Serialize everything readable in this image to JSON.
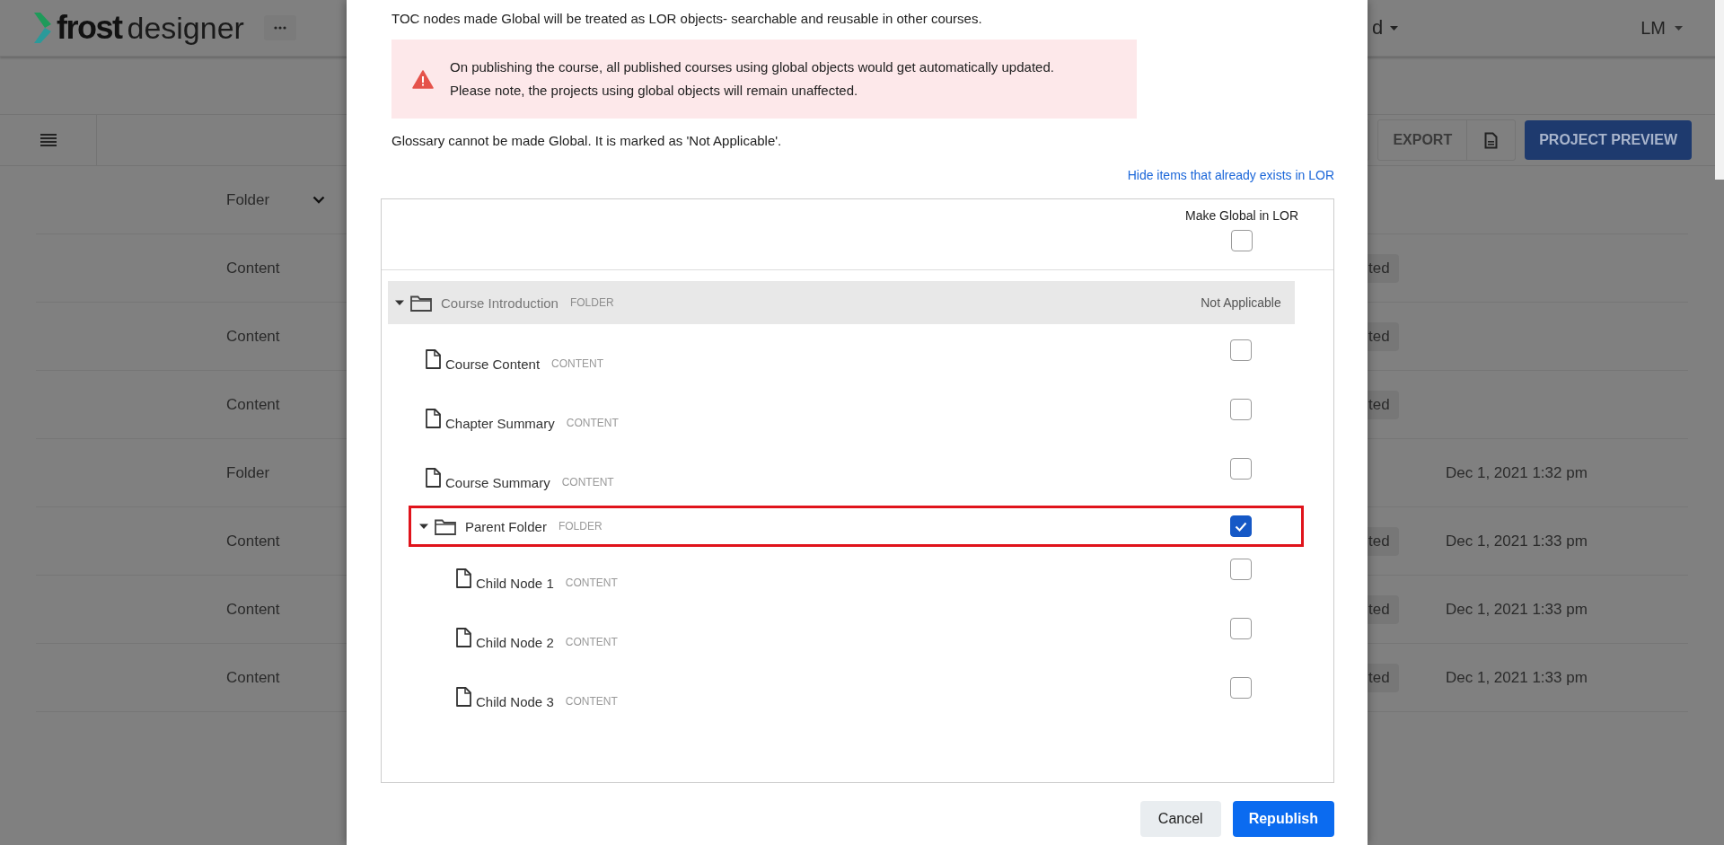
{
  "header": {
    "logo_bold": "frost",
    "logo_light": "designer",
    "menu_partial": "d",
    "user": "LM"
  },
  "toolbar": {
    "export_button": "EXPORT",
    "preview_button": "PROJECT PREVIEW"
  },
  "table": {
    "filter": "Folder",
    "rows": [
      {
        "type": "Content",
        "status": "ted"
      },
      {
        "type": "Content",
        "status": "ted"
      },
      {
        "type": "Content",
        "status": "ted"
      },
      {
        "type": "Folder",
        "date": "Dec 1, 2021 1:32 pm"
      },
      {
        "type": "Content",
        "status": "ted",
        "date": "Dec 1, 2021 1:33 pm"
      },
      {
        "type": "Content",
        "status": "ted",
        "date": "Dec 1, 2021 1:33 pm"
      },
      {
        "type": "Content",
        "status": "ted",
        "date": "Dec 1, 2021 1:33 pm"
      }
    ]
  },
  "dialog": {
    "intro": "TOC nodes made Global will be treated as LOR objects- searchable and reusable in other courses.",
    "alert": [
      "On publishing the course, all published courses using global objects would get automatically updated.",
      "Please note, the projects using global objects will remain unaffected."
    ],
    "note": "Glossary cannot be made Global. It is marked as 'Not Applicable'.",
    "hide_link": "Hide items that already exists in LOR",
    "tree": {
      "column": "Make Global in LOR",
      "header_checked": false,
      "nodes": [
        {
          "kind": "folder",
          "name": "Course Introduction",
          "type": "FOLDER",
          "expanded": true,
          "status": "Not Applicable",
          "highlighted": false,
          "children": [
            {
              "kind": "file",
              "name": "Course Content",
              "type": "CONTENT",
              "checked": false,
              "highlighted": false
            },
            {
              "kind": "file",
              "name": "Chapter Summary",
              "type": "CONTENT",
              "checked": false,
              "highlighted": false
            },
            {
              "kind": "file",
              "name": "Course Summary",
              "type": "CONTENT",
              "checked": false,
              "highlighted": false
            },
            {
              "kind": "folder",
              "name": "Parent Folder",
              "type": "FOLDER",
              "expanded": true,
              "checked": true,
              "highlighted": true,
              "children": [
                {
                  "kind": "file",
                  "name": "Child Node 1",
                  "type": "CONTENT",
                  "checked": false,
                  "highlighted": false
                },
                {
                  "kind": "file",
                  "name": "Child Node 2",
                  "type": "CONTENT",
                  "checked": false,
                  "highlighted": false
                },
                {
                  "kind": "file",
                  "name": "Child Node 3",
                  "type": "CONTENT",
                  "checked": false,
                  "highlighted": false
                }
              ]
            }
          ]
        }
      ]
    },
    "cancel_button": "Cancel",
    "confirm_button": "Republish"
  }
}
